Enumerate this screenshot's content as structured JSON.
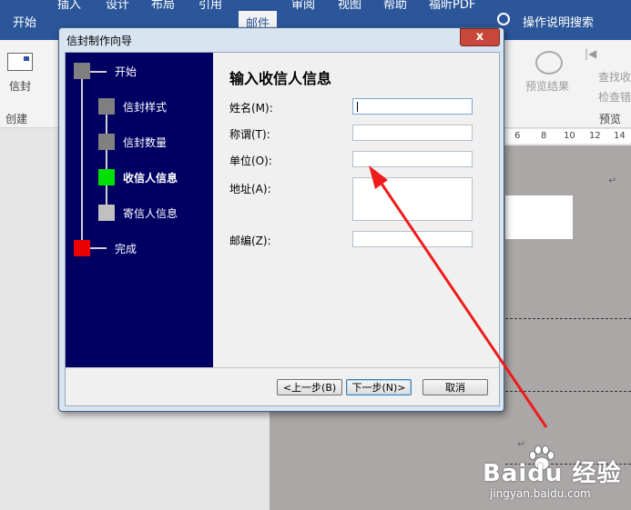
{
  "ribbon": {
    "tabs": [
      {
        "label": "开始"
      },
      {
        "label": "插入"
      },
      {
        "label": "设计"
      },
      {
        "label": "布局"
      },
      {
        "label": "引用"
      },
      {
        "label": "邮件"
      },
      {
        "label": "审阅"
      },
      {
        "label": "视图"
      },
      {
        "label": "帮助"
      },
      {
        "label": "福昕PDF"
      }
    ],
    "active_tab": "邮件",
    "tell_me": "操作说明搜索",
    "envelope_label": "信封",
    "create_group": "创建",
    "preview_results": "预览结果",
    "find_recipient": "查找收",
    "check_errors": "检查错",
    "preview_group": "预览结",
    "ruler_marks": [
      "6",
      "8",
      "10",
      "12",
      "14"
    ]
  },
  "dialog": {
    "title": "信封制作向导",
    "close_glyph": "x",
    "steps": [
      {
        "label": "开始",
        "color": "#808080"
      },
      {
        "label": "信封样式",
        "color": "#808080"
      },
      {
        "label": "信封数量",
        "color": "#808080"
      },
      {
        "label": "收信人信息",
        "color": "#00e000",
        "current": true
      },
      {
        "label": "寄信人信息",
        "color": "#c0c0c0"
      },
      {
        "label": "完成",
        "color": "#ee0000"
      }
    ],
    "heading": "输入收信人信息",
    "fields": [
      {
        "label": "姓名(M):",
        "value": ""
      },
      {
        "label": "称谓(T):",
        "value": ""
      },
      {
        "label": "单位(O):",
        "value": ""
      },
      {
        "label": "地址(A):",
        "value": ""
      },
      {
        "label": "邮编(Z):",
        "value": ""
      }
    ],
    "buttons": {
      "back": "<上一步(B)",
      "next": "下一步(N)>",
      "cancel": "取消"
    }
  },
  "watermark": {
    "brand": "Baidu 经验",
    "url": "jingyan.baidu.com"
  },
  "colors": {
    "ribbon_blue": "#2b579a",
    "wizard_panel": "#000063",
    "arrow": "#ee1c1c"
  }
}
